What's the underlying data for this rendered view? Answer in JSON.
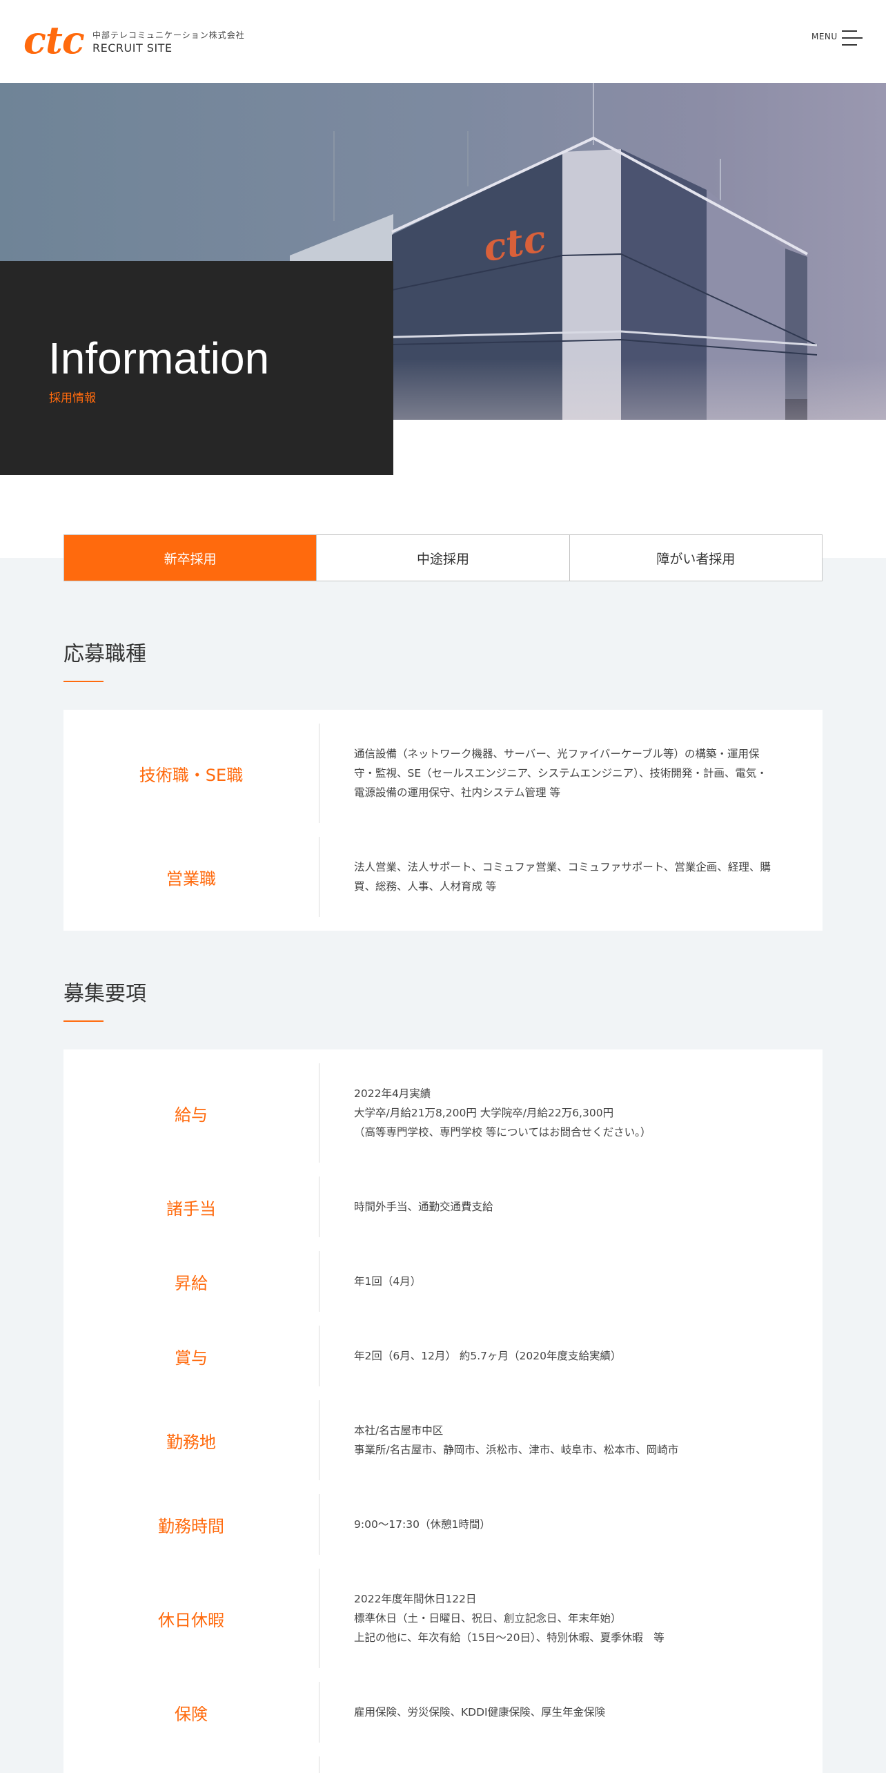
{
  "header": {
    "logo": "ctc",
    "company": "中部テレコミュニケーション株式会社",
    "site": "RECRUIT SITE",
    "menu_label": "MENU"
  },
  "hero": {
    "title": "Information",
    "subtitle": "採用情報",
    "building_logo": "ctc"
  },
  "tabs": [
    {
      "label": "新卒採用",
      "active": true
    },
    {
      "label": "中途採用",
      "active": false
    },
    {
      "label": "障がい者採用",
      "active": false
    }
  ],
  "positions": {
    "title": "応募職種",
    "rows": [
      {
        "label": "技術職・SE職",
        "lines": [
          "通信設備（ネットワーク機器、サーバー、光ファイバーケーブル等）の構築・運用保",
          "守・監視、SE（セールスエンジニア、システムエンジニア）、技術開発・計画、電気・",
          "電源設備の運用保守、社内システム管理 等"
        ]
      },
      {
        "label": "営業職",
        "lines": [
          "法人営業、法人サポート、コミュファ営業、コミュファサポート、営業企画、経理、購",
          "買、総務、人事、人材育成 等"
        ]
      }
    ]
  },
  "requirements": {
    "title": "募集要項",
    "rows": [
      {
        "label": "給与",
        "lines": [
          "2022年4月実績",
          "大学卒/月給21万8,200円 大学院卒/月給22万6,300円",
          "（高等専門学校、専門学校 等についてはお問合せください。）"
        ]
      },
      {
        "label": "諸手当",
        "lines": [
          "時間外手当、通勤交通費支給"
        ]
      },
      {
        "label": "昇給",
        "lines": [
          "年1回（4月）"
        ]
      },
      {
        "label": "賞与",
        "lines": [
          "年2回（6月、12月） 約5.7ヶ月（2020年度支給実績）"
        ]
      },
      {
        "label": "勤務地",
        "lines": [
          "本社/名古屋市中区",
          "事業所/名古屋市、静岡市、浜松市、津市、岐阜市、松本市、岡崎市"
        ]
      },
      {
        "label": "勤務時間",
        "lines": [
          "9:00～17:30（休憩1時間）"
        ]
      },
      {
        "label": "休日休暇",
        "lines": [
          "2022年度年間休日122日",
          "標準休日（土・日曜日、祝日、創立記念日、年末年始）",
          "上記の他に、年次有給（15日～20日）、特別休暇、夏季休暇　等"
        ]
      },
      {
        "label": "保険",
        "lines": [
          "雇用保険、労災保険、KDDI健康保険、厚生年金保険"
        ]
      }
    ]
  },
  "colors": {
    "accent": "#ff6a0d",
    "dark": "#262626",
    "bg": "#f1f4f6"
  }
}
